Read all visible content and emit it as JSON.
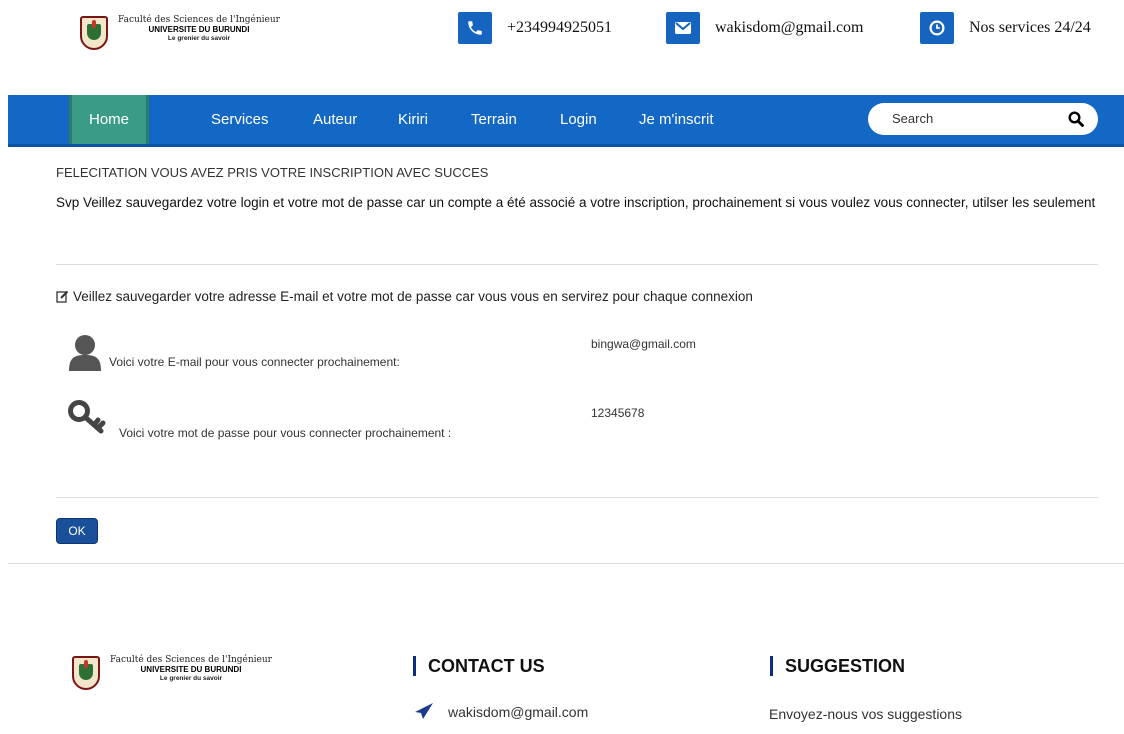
{
  "header": {
    "logo": {
      "faculty": "Faculté des Sciences de l'Ingénieur",
      "university": "UNIVERSITE DU BURUNDI",
      "motto": "Le grenier du savoir"
    },
    "phone": "+234994925051",
    "email": "wakisdom@gmail.com",
    "services": "Nos services 24/24"
  },
  "nav": {
    "items": [
      "Home",
      "Services",
      "Auteur",
      "Kiriri",
      "Terrain",
      "Login",
      "Je m'inscrit"
    ],
    "active": "Home",
    "search_placeholder": "Search"
  },
  "main": {
    "title": "FELECITATION VOUS AVEZ PRIS VOTRE INSCRIPTION AVEC SUCCES",
    "message": "Svp Veillez sauvegardez votre login et votre mot de passe car un compte a été associé a votre inscription, prochainement si vous voulez vous connecter, utilser les seulement",
    "note": "Veillez sauvegarder votre adresse E-mail et votre mot de passe car vous vous en servirez pour chaque connexion",
    "email_label": "Voici votre E-mail pour vous connecter prochainement:",
    "email_value": "bingwa@gmail.com",
    "password_label": "Voici votre mot de passe pour vous connecter prochainement :",
    "password_value": "12345678",
    "ok_label": "OK"
  },
  "footer": {
    "contact_heading": "CONTACT US",
    "contact_email": "wakisdom@gmail.com",
    "suggestion_heading": "SUGGESTION",
    "suggestion_text": "Envoyez-nous vos suggestions"
  },
  "colors": {
    "nav": "#1268c4",
    "nav_active": "#3a9b86",
    "icon_bg": "#1565c0",
    "button": "#1a4f9a"
  }
}
